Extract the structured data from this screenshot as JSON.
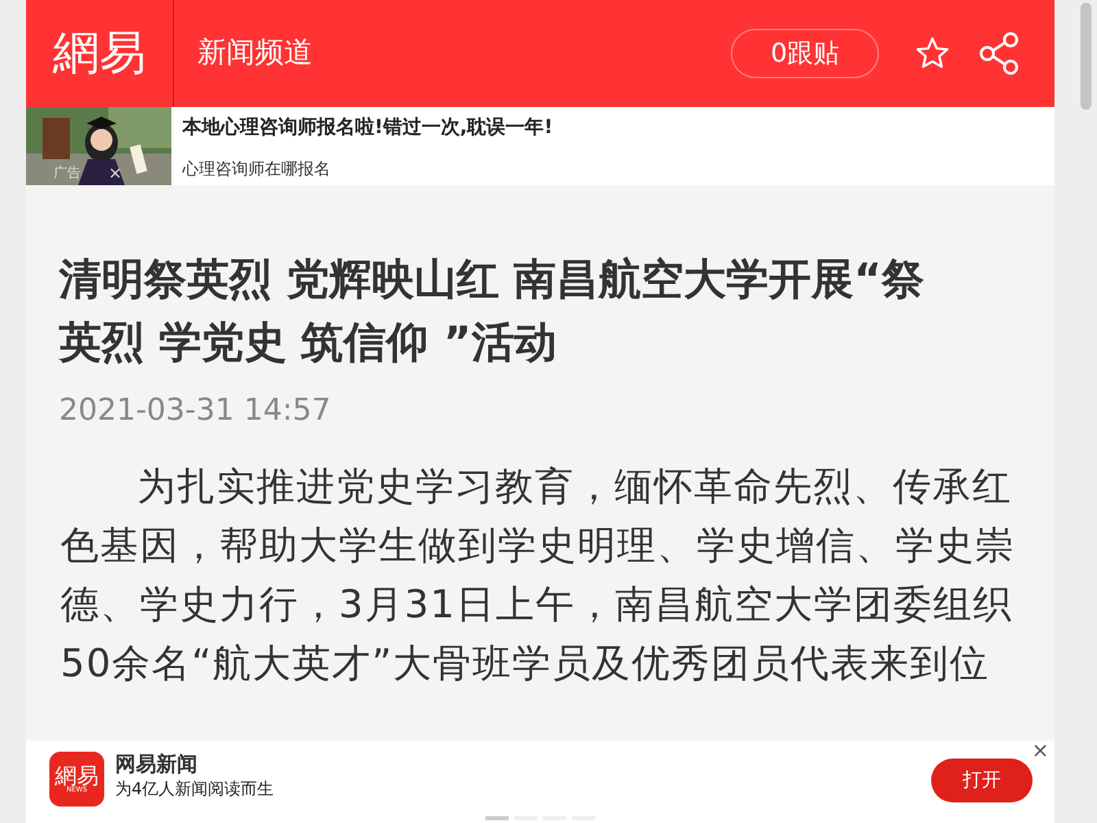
{
  "header": {
    "logo": "網易",
    "channel": "新闻频道",
    "comment_button": "0跟贴"
  },
  "ad": {
    "kind": "picture",
    "badge": "广告",
    "close": "×",
    "headline": "本地心理咨询师报名啦!错过一次,耽误一年!",
    "subline": "心理咨询师在哪报名"
  },
  "article": {
    "title": "清明祭英烈 党辉映山红 南昌航空大学开展“祭英烈 学党史 筑信仰 ”活动",
    "date": "2021-03-31 14:57",
    "paragraph": "为扎实推进党史学习教育，缅怀革命先烈、传承红色基因，帮助大学生做到学史明理、学史增信、学史崇德、学史力行，3月31日上午，南昌航空大学团委组织50余名“航大英才”大骨班学员及优秀团员代表来到位"
  },
  "app_banner": {
    "icon_logo": "網易",
    "icon_sub": "NEWS",
    "name": "网易新闻",
    "slogan": "为4亿人新闻阅读而生",
    "open_button": "打开",
    "close": "×",
    "pager": [
      {
        "selected": true
      },
      {
        "selected": false
      },
      {
        "selected": false
      },
      {
        "selected": false
      }
    ]
  }
}
